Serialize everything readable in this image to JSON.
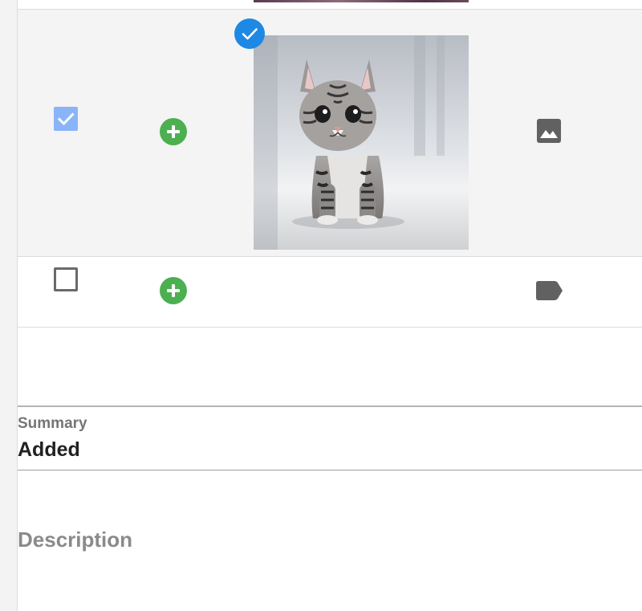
{
  "rows": [
    {
      "selected": true,
      "checked": true,
      "type_icon": "image-icon",
      "thumbnail": "kitten-photo"
    },
    {
      "selected": false,
      "checked": false,
      "type_icon": "label-tag-icon"
    }
  ],
  "form": {
    "summary_label": "Summary",
    "summary_value": "Added",
    "description_label": "Description"
  },
  "colors": {
    "selected_row_bg": "#f4f4f4",
    "checkbox_checked": "#8ab4f8",
    "add_button": "#4caf50",
    "selection_badge": "#1e88e5",
    "icon_gray": "#616161"
  }
}
